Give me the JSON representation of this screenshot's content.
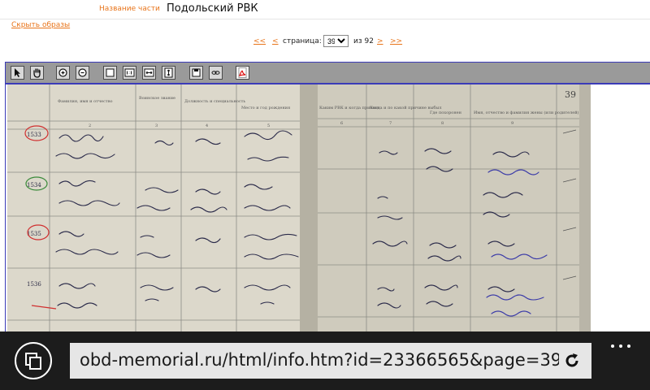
{
  "header": {
    "part_label": "Название части",
    "part_value": "Подольский РВК"
  },
  "hide_images_link": "Скрыть образы",
  "pager": {
    "first": "<<",
    "prev": "<",
    "page_label": "страница:",
    "current_page": "39",
    "of_label": "из 92",
    "next": ">",
    "last": ">>"
  },
  "toolbar": {
    "buttons": [
      "select-arrow-icon",
      "hand-pan-icon",
      "zoom-in-icon",
      "zoom-out-icon",
      "fit-page-icon",
      "actual-size-icon",
      "fit-width-icon",
      "fit-height-icon",
      "save-icon",
      "link-icon",
      "pdf-icon"
    ]
  },
  "document": {
    "page_number": "39",
    "left_headers": [
      "Фамилия, имя и отчество",
      "Воинское звание",
      "Должность и специальность",
      "Место и год рождения"
    ],
    "right_headers": [
      "Каким РВК и когда призван",
      "Когда и по какой причине выбыл",
      "Где похоронен",
      "Имя, отчество и фамилия жены (или родителей)"
    ],
    "column_numbers": [
      "2",
      "3",
      "4",
      "5",
      "6",
      "7",
      "8",
      "9"
    ],
    "row_numbers": [
      "1533",
      "1534",
      "1535",
      "1536"
    ]
  },
  "browser": {
    "url": "obd-memorial.ru/html/info.htm?id=23366565&page=39"
  }
}
